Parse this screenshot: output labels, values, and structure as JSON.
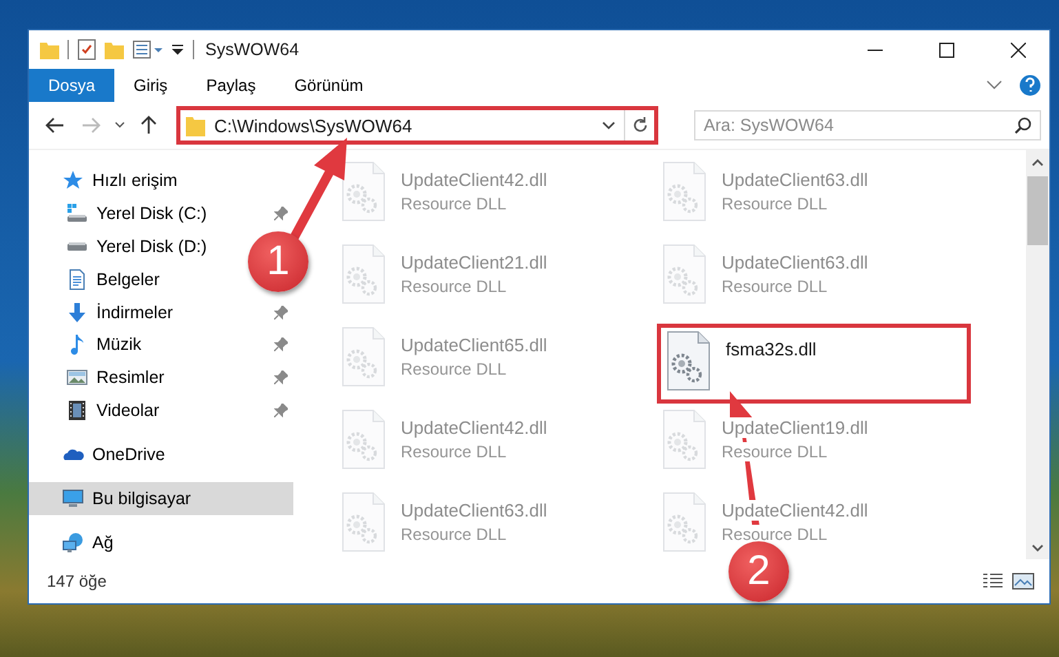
{
  "window": {
    "title": "SysWOW64"
  },
  "ribbon_tabs": [
    {
      "label": "Dosya",
      "kind": "file"
    },
    {
      "label": "Giriş",
      "kind": "tab"
    },
    {
      "label": "Paylaş",
      "kind": "tab"
    },
    {
      "label": "Görünüm",
      "kind": "tab"
    }
  ],
  "address_bar": {
    "path": "C:\\Windows\\SysWOW64",
    "highlighted": true
  },
  "search": {
    "placeholder": "Ara: SysWOW64"
  },
  "sidebar": {
    "items": [
      {
        "label": "Hızlı erişim",
        "kind": "star",
        "selected": false,
        "children": [
          {
            "label": "Yerel Disk (C:)",
            "kind": "windrive",
            "pinned": true,
            "selected": false
          },
          {
            "label": "Yerel Disk (D:)",
            "kind": "drive",
            "pinned": false,
            "selected": false
          },
          {
            "label": "Belgeler",
            "kind": "docs",
            "pinned": false,
            "selected": false
          },
          {
            "label": "İndirmeler",
            "kind": "download",
            "pinned": true,
            "selected": false
          },
          {
            "label": "Müzik",
            "kind": "music",
            "pinned": true,
            "selected": false
          },
          {
            "label": "Resimler",
            "kind": "pictures",
            "pinned": true,
            "selected": false
          },
          {
            "label": "Videolar",
            "kind": "videos",
            "pinned": true,
            "selected": false
          }
        ]
      },
      {
        "label": "OneDrive",
        "kind": "cloud",
        "selected": false
      },
      {
        "label": "Bu bilgisayar",
        "kind": "computer",
        "selected": true
      },
      {
        "label": "Ağ",
        "kind": "network",
        "selected": false
      }
    ]
  },
  "files": [
    {
      "name": "UpdateClient42.dll",
      "type": "Resource DLL",
      "faded": true,
      "highlighted": false
    },
    {
      "name": "UpdateClient63.dll",
      "type": "Resource DLL",
      "faded": true,
      "highlighted": false
    },
    {
      "name": "UpdateClient21.dll",
      "type": "Resource DLL",
      "faded": true,
      "highlighted": false
    },
    {
      "name": "UpdateClient63.dll",
      "type": "Resource DLL",
      "faded": true,
      "highlighted": false
    },
    {
      "name": "UpdateClient65.dll",
      "type": "Resource DLL",
      "faded": true,
      "highlighted": false
    },
    {
      "name": "fsma32s.dll",
      "faded": false,
      "highlighted": true
    },
    {
      "name": "UpdateClient42.dll",
      "type": "Resource DLL",
      "faded": true,
      "highlighted": false
    },
    {
      "name": "UpdateClient19.dll",
      "type": "Resource DLL",
      "faded": true,
      "highlighted": false
    },
    {
      "name": "UpdateClient63.dll",
      "type": "Resource DLL",
      "faded": true,
      "highlighted": false
    },
    {
      "name": "UpdateClient42.dll",
      "type": "Resource DLL",
      "faded": true,
      "highlighted": false
    }
  ],
  "annotations": [
    {
      "label": "1"
    },
    {
      "label": "2"
    }
  ],
  "status_bar": {
    "item_count": "147 öğe"
  }
}
